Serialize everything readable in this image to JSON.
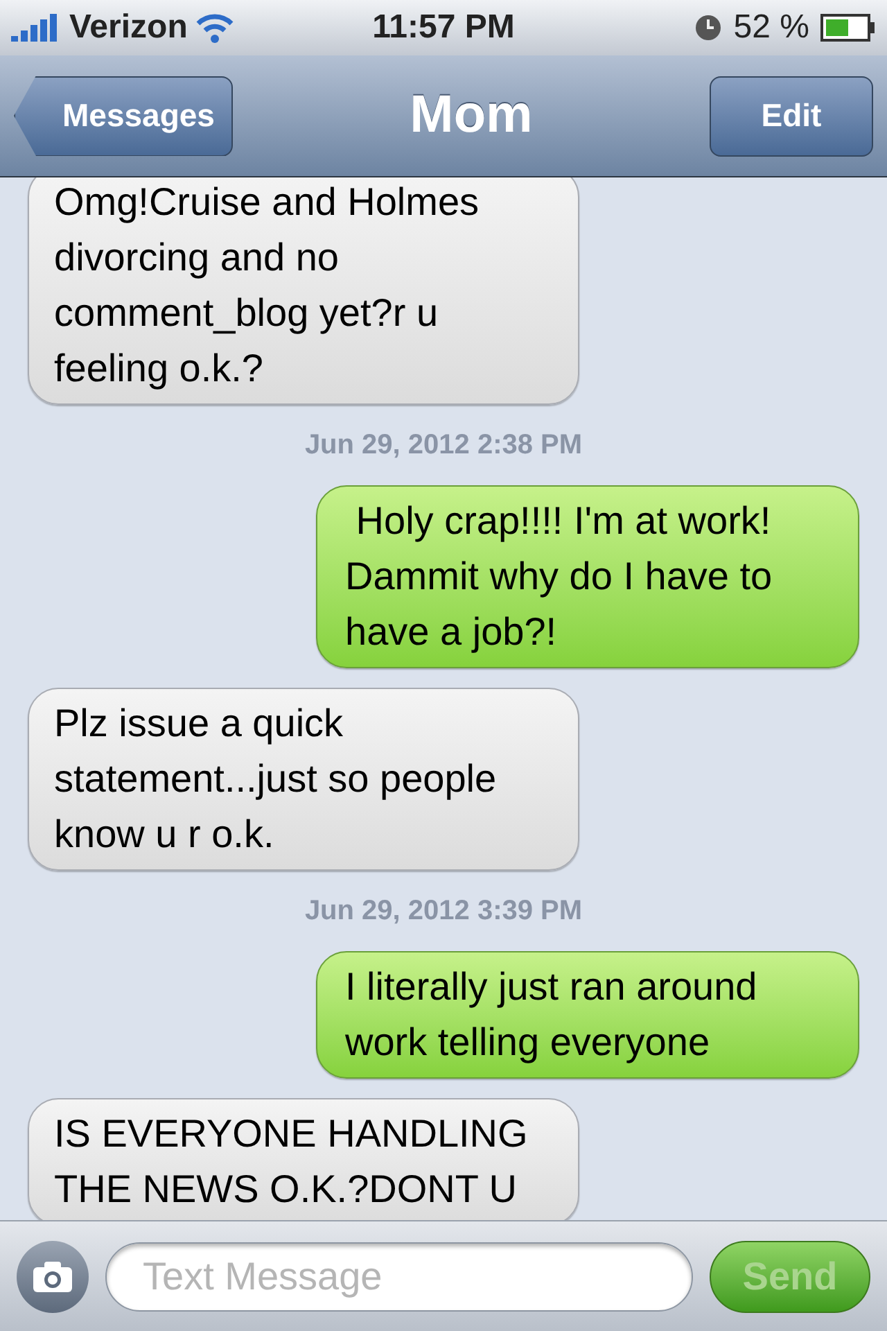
{
  "status_bar": {
    "carrier": "Verizon",
    "time": "11:57 PM",
    "battery": "52 %"
  },
  "nav": {
    "back": "Messages",
    "title": "Mom",
    "edit": "Edit"
  },
  "messages": [
    {
      "kind": "received",
      "text": "Omg!Cruise and Holmes divorcing and no comment_blog yet?r u feeling o.k.?"
    },
    {
      "kind": "timestamp",
      "text": "Jun 29, 2012 2:38 PM"
    },
    {
      "kind": "sent",
      "text": " Holy crap!!!! I'm at work! Dammit why do I have to have a job?!"
    },
    {
      "kind": "received",
      "text": "Plz issue a quick statement...just so people know u r o.k."
    },
    {
      "kind": "timestamp",
      "text": "Jun 29, 2012 3:39 PM"
    },
    {
      "kind": "sent",
      "text": "I literally just ran around work telling everyone"
    },
    {
      "kind": "received",
      "text": "IS EVERYONE HANDLING THE NEWS O.K.?DONT U"
    }
  ],
  "composer": {
    "placeholder": "Text Message",
    "send": "Send",
    "disabled": true
  }
}
